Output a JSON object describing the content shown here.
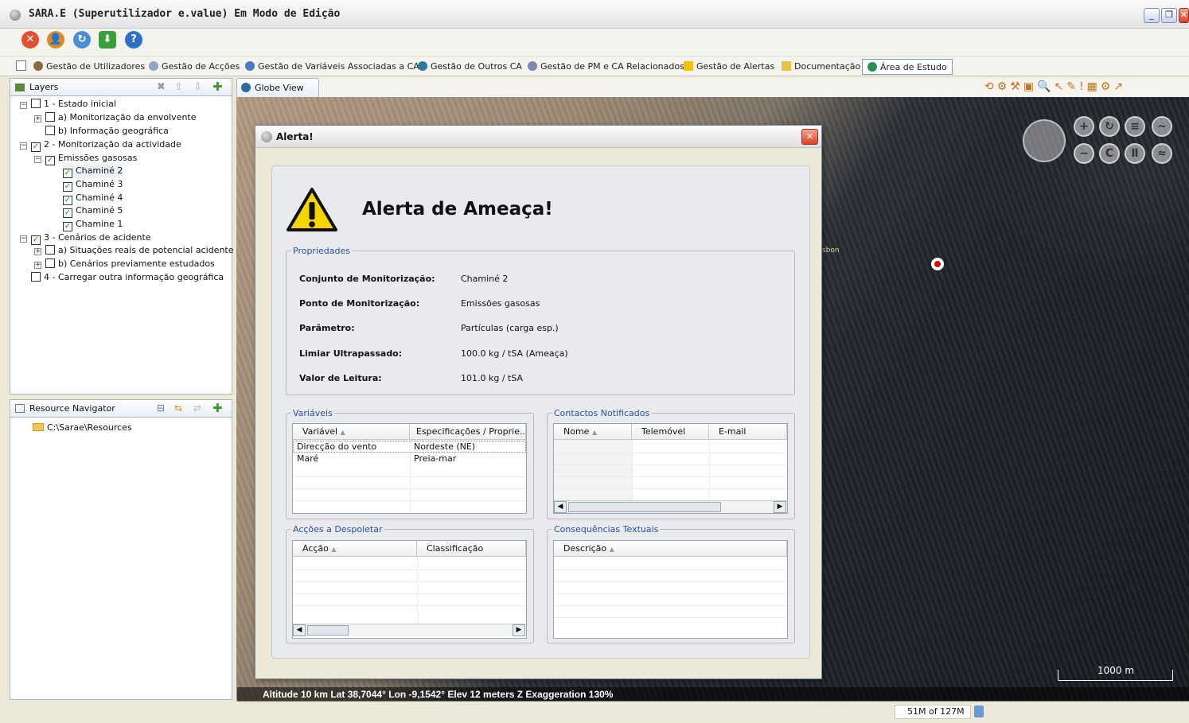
{
  "window": {
    "title": "SARA.E (Superutilizador e.value)  Em Modo de Edição"
  },
  "menu": [
    {
      "label": "Gestão de Utilizadores",
      "icon": "users-icon"
    },
    {
      "label": "Gestão de Acções",
      "icon": "actions-icon"
    },
    {
      "label": "Gestão de Variáveis Associadas a CA",
      "icon": "variables-icon"
    },
    {
      "label": "Gestão de Outros CA",
      "icon": "globe-icon"
    },
    {
      "label": "Gestão de PM e CA Relacionados",
      "icon": "search-icon"
    },
    {
      "label": "Gestão de Alertas",
      "icon": "warning-icon"
    },
    {
      "label": "Documentação",
      "icon": "book-icon"
    },
    {
      "label": "Área de Estudo",
      "icon": "globe-icon"
    }
  ],
  "layers": {
    "tab": "Layers",
    "items": [
      {
        "label": "1 - Estado inicial",
        "checked": false
      },
      {
        "label": "a) Monitorização da envolvente",
        "checked": false
      },
      {
        "label": "b) Informação geográfica",
        "checked": false
      },
      {
        "label": "2 - Monitorização da actividade",
        "checked": true
      },
      {
        "label": "Emissões gasosas",
        "checked": true
      },
      {
        "label": "Chaminé 2",
        "checked": true
      },
      {
        "label": "Chaminé 3",
        "checked": true
      },
      {
        "label": "Chaminé 4",
        "checked": true
      },
      {
        "label": "Chaminé 5",
        "checked": true
      },
      {
        "label": "Chamine 1",
        "checked": true
      },
      {
        "label": "3 - Cenários de acidente",
        "checked": true
      },
      {
        "label": "a) Situações reais de potencial acidente",
        "checked": false
      },
      {
        "label": "b) Cenários previamente estudados",
        "checked": false
      },
      {
        "label": "4 - Carregar outra informação geográfica",
        "checked": false
      }
    ]
  },
  "resources": {
    "tab": "Resource Navigator",
    "path": "C:\\Sarae\\Resources"
  },
  "globe": {
    "tab": "Globe View",
    "status": "Altitude 10 km   Lat 38,7044° Lon -9,1542°   Elev 12 meters   Z Exaggeration 130%",
    "scale": "1000 m",
    "map_label": "sbon"
  },
  "dialog": {
    "title": "Alerta!",
    "heading": "Alerta de Ameaça!",
    "properties": {
      "legend": "Propriedades",
      "rows": [
        {
          "key": "Conjunto de Monitorização:",
          "value": "Chaminé 2"
        },
        {
          "key": "Ponto de Monitorização:",
          "value": "Emissões gasosas"
        },
        {
          "key": "Parâmetro:",
          "value": "Partículas (carga esp.)"
        },
        {
          "key": "Limiar Ultrapassado:",
          "value": "100.0 kg / tSA  (Ameaça)"
        },
        {
          "key": "Valor de Leitura:",
          "value": "101.0 kg / tSA"
        }
      ]
    },
    "variaveis": {
      "legend": "Variáveis",
      "columns": [
        "Variável",
        "Especificações / Proprie..."
      ],
      "rows": [
        [
          "Direcção do vento",
          "Nordeste (NE)"
        ],
        [
          "Maré",
          "Preia-mar"
        ]
      ]
    },
    "contactos": {
      "legend": "Contactos Notificados",
      "columns": [
        "Nome",
        "Telemóvel",
        "E-mail"
      ]
    },
    "accoes": {
      "legend": "Acções a Despoletar",
      "columns": [
        "Acção",
        "Classificação"
      ]
    },
    "consequencias": {
      "legend": "Consequências Textuais",
      "columns": [
        "Descrição"
      ]
    }
  },
  "memory": {
    "used": "51M",
    "of": "of 127M"
  }
}
